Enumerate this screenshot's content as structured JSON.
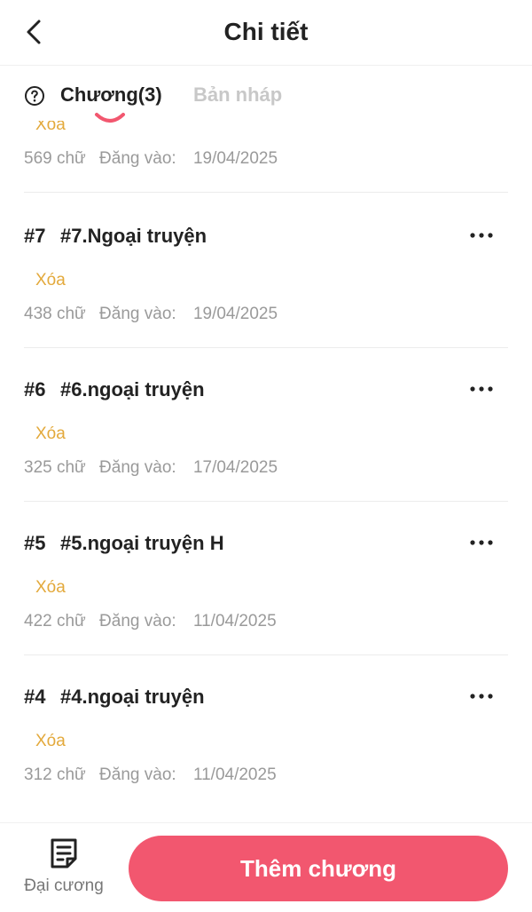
{
  "header": {
    "title": "Chi tiết"
  },
  "tabs": [
    {
      "label": "Chương(3)",
      "active": true
    },
    {
      "label": "Bản nháp",
      "active": false
    }
  ],
  "chapters": [
    {
      "num": "",
      "title": "",
      "status": "Xóa",
      "words": "569 chữ",
      "posted_label": "Đăng vào:",
      "date": "19/04/2025"
    },
    {
      "num": "#7",
      "title": "#7.Ngoại truyện",
      "status": "Xóa",
      "words": "438 chữ",
      "posted_label": "Đăng vào:",
      "date": "19/04/2025"
    },
    {
      "num": "#6",
      "title": "#6.ngoại truyện",
      "status": "Xóa",
      "words": "325 chữ",
      "posted_label": "Đăng vào:",
      "date": "17/04/2025"
    },
    {
      "num": "#5",
      "title": "#5.ngoại truyện H",
      "status": "Xóa",
      "words": "422 chữ",
      "posted_label": "Đăng vào:",
      "date": "11/04/2025"
    },
    {
      "num": "#4",
      "title": "#4.ngoại truyện",
      "status": "Xóa",
      "words": "312 chữ",
      "posted_label": "Đăng vào:",
      "date": "11/04/2025"
    }
  ],
  "bottom": {
    "outline_label": "Đại cương",
    "add_label": "Thêm chương"
  },
  "colors": {
    "accent": "#f2576f",
    "status": "#e3a93b",
    "muted": "#9a9a9a"
  },
  "icons": {
    "back": "chevron-left-icon",
    "help": "question-circle-icon",
    "more": "more-horizontal-icon",
    "outline": "document-list-icon"
  }
}
